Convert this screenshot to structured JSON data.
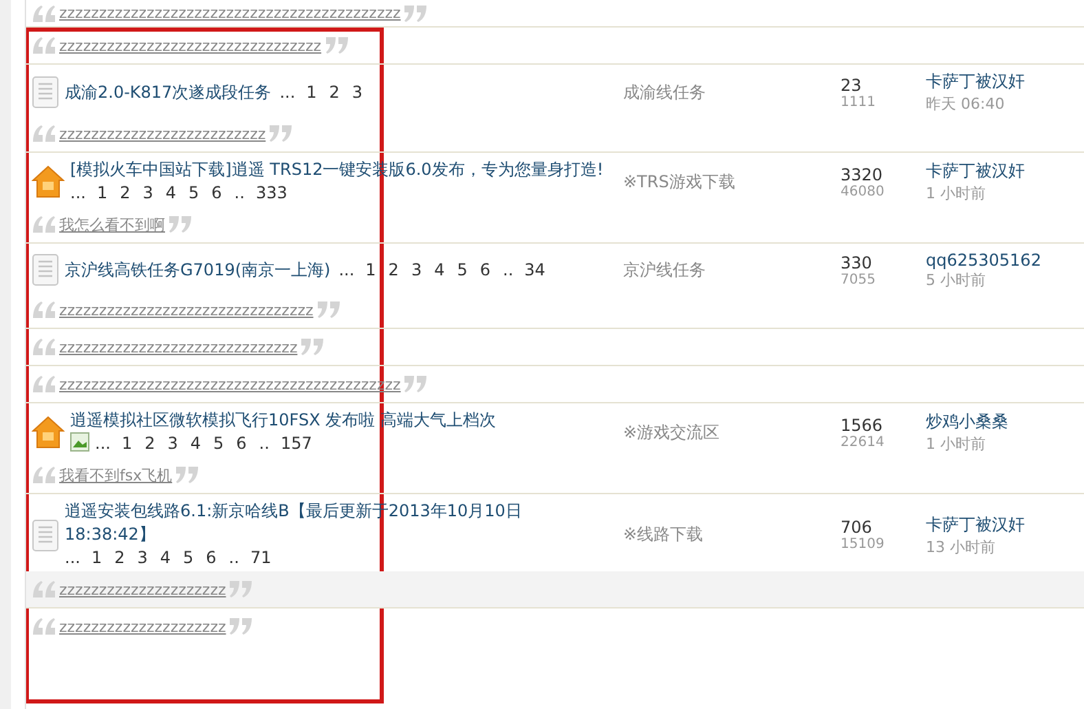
{
  "groups": [
    {
      "highlighted": false,
      "quote": "zzzzzzzzzzzzzzzzzzzzzzzzzzzzzzzzzzzzzzzzzzz"
    },
    {
      "highlighted": false,
      "quote": "zzzzzzzzzzzzzzzzzzzzzzzzzzzzzzzzz"
    },
    {
      "highlighted": false,
      "thread": {
        "kind": "normal",
        "title": "成渝2.0-K817次遂成段任务",
        "pages": [
          {
            "kind": "gap",
            "text": "..."
          },
          {
            "kind": "page",
            "text": "1"
          },
          {
            "kind": "page",
            "text": "2"
          },
          {
            "kind": "page",
            "text": "3"
          }
        ],
        "forum": "成渝线任务",
        "replies": "23",
        "views": "1111",
        "author": "卡萨丁被汉奸",
        "time": "昨天 06:40"
      },
      "quote": "zzzzzzzzzzzzzzzzzzzzzzzzzz"
    },
    {
      "highlighted": false,
      "thread": {
        "kind": "pinned",
        "title": "[模拟火车中国站下载]逍遥 TRS12一键安装版6.0发布，专为您量身打造!",
        "pages": [
          {
            "kind": "gap",
            "text": "..."
          },
          {
            "kind": "page",
            "text": "1"
          },
          {
            "kind": "page",
            "text": "2"
          },
          {
            "kind": "page",
            "text": "3"
          },
          {
            "kind": "page",
            "text": "4"
          },
          {
            "kind": "page",
            "text": "5"
          },
          {
            "kind": "page",
            "text": "6"
          },
          {
            "kind": "gap",
            "text": ".."
          },
          {
            "kind": "page",
            "text": "333"
          }
        ],
        "forum": "※TRS游戏下载",
        "replies": "3320",
        "views": "46080",
        "author": "卡萨丁被汉奸",
        "time": "1 小时前"
      },
      "quote": "我怎么看不到啊"
    },
    {
      "highlighted": false,
      "thread": {
        "kind": "normal",
        "title": "京沪线高铁任务G7019(南京一上海)",
        "pages": [
          {
            "kind": "gap",
            "text": "..."
          },
          {
            "kind": "page",
            "text": "1"
          },
          {
            "kind": "page",
            "text": "2"
          },
          {
            "kind": "page",
            "text": "3"
          },
          {
            "kind": "page",
            "text": "4"
          },
          {
            "kind": "page",
            "text": "5"
          },
          {
            "kind": "page",
            "text": "6"
          },
          {
            "kind": "gap",
            "text": ".."
          },
          {
            "kind": "page",
            "text": "34"
          }
        ],
        "forum": "京沪线任务",
        "replies": "330",
        "views": "7055",
        "author": "qq625305162",
        "time": "5 小时前"
      },
      "quote": "zzzzzzzzzzzzzzzzzzzzzzzzzzzzzzzz"
    },
    {
      "highlighted": false,
      "quote": "zzzzzzzzzzzzzzzzzzzzzzzzzzzzzz"
    },
    {
      "highlighted": false,
      "quote": "zzzzzzzzzzzzzzzzzzzzzzzzzzzzzzzzzzzzzzzzzzz"
    },
    {
      "highlighted": false,
      "thread": {
        "kind": "pinned",
        "title": "逍遥模拟社区微软模拟飞行10FSX 发布啦 高端大气上档次",
        "image_attachment": true,
        "pages": [
          {
            "kind": "gap",
            "text": "..."
          },
          {
            "kind": "page",
            "text": "1"
          },
          {
            "kind": "page",
            "text": "2"
          },
          {
            "kind": "page",
            "text": "3"
          },
          {
            "kind": "page",
            "text": "4"
          },
          {
            "kind": "page",
            "text": "5"
          },
          {
            "kind": "page",
            "text": "6"
          },
          {
            "kind": "gap",
            "text": ".."
          },
          {
            "kind": "page",
            "text": "157"
          }
        ],
        "forum": "※游戏交流区",
        "replies": "1566",
        "views": "22614",
        "author": "炒鸡小桑桑",
        "time": "1 小时前"
      },
      "quote": "我看不到fsx飞机"
    },
    {
      "highlighted": true,
      "thread": {
        "kind": "normal",
        "title": "逍遥安装包线路6.1:新京哈线B【最后更新于2013年10月10日 18:38:42】",
        "pages": [
          {
            "kind": "gap",
            "text": "..."
          },
          {
            "kind": "page",
            "text": "1"
          },
          {
            "kind": "page",
            "text": "2"
          },
          {
            "kind": "page",
            "text": "3"
          },
          {
            "kind": "page",
            "text": "4"
          },
          {
            "kind": "page",
            "text": "5"
          },
          {
            "kind": "page",
            "text": "6"
          },
          {
            "kind": "gap",
            "text": ".."
          },
          {
            "kind": "page",
            "text": "71"
          }
        ],
        "forum": "※线路下载",
        "replies": "706",
        "views": "15109",
        "author": "卡萨丁被汉奸",
        "time": "13 小时前"
      },
      "quote": "zzzzzzzzzzzzzzzzzzzzz"
    },
    {
      "highlighted": false,
      "quote": "zzzzzzzzzzzzzzzzzzzzz"
    }
  ]
}
